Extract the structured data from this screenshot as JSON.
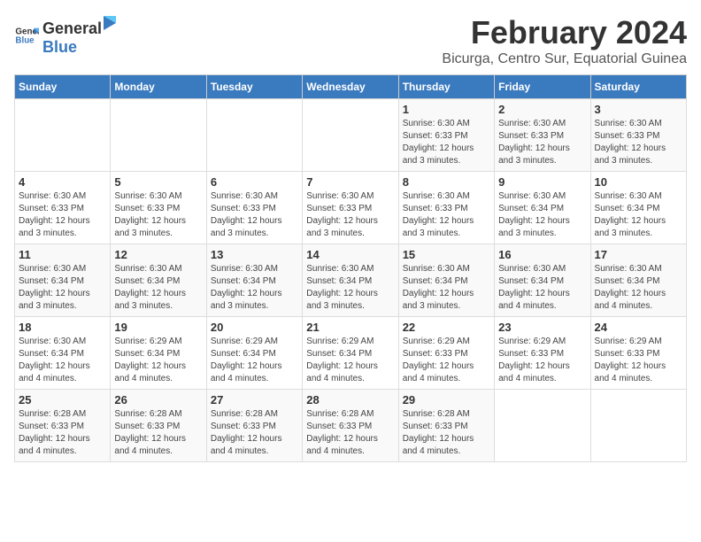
{
  "header": {
    "logo": {
      "general": "General",
      "blue": "Blue"
    },
    "title": "February 2024",
    "subtitle": "Bicurga, Centro Sur, Equatorial Guinea"
  },
  "days_of_week": [
    "Sunday",
    "Monday",
    "Tuesday",
    "Wednesday",
    "Thursday",
    "Friday",
    "Saturday"
  ],
  "weeks": [
    [
      {
        "day": "",
        "info": ""
      },
      {
        "day": "",
        "info": ""
      },
      {
        "day": "",
        "info": ""
      },
      {
        "day": "",
        "info": ""
      },
      {
        "day": "1",
        "info": "Sunrise: 6:30 AM\nSunset: 6:33 PM\nDaylight: 12 hours and 3 minutes."
      },
      {
        "day": "2",
        "info": "Sunrise: 6:30 AM\nSunset: 6:33 PM\nDaylight: 12 hours and 3 minutes."
      },
      {
        "day": "3",
        "info": "Sunrise: 6:30 AM\nSunset: 6:33 PM\nDaylight: 12 hours and 3 minutes."
      }
    ],
    [
      {
        "day": "4",
        "info": "Sunrise: 6:30 AM\nSunset: 6:33 PM\nDaylight: 12 hours and 3 minutes."
      },
      {
        "day": "5",
        "info": "Sunrise: 6:30 AM\nSunset: 6:33 PM\nDaylight: 12 hours and 3 minutes."
      },
      {
        "day": "6",
        "info": "Sunrise: 6:30 AM\nSunset: 6:33 PM\nDaylight: 12 hours and 3 minutes."
      },
      {
        "day": "7",
        "info": "Sunrise: 6:30 AM\nSunset: 6:33 PM\nDaylight: 12 hours and 3 minutes."
      },
      {
        "day": "8",
        "info": "Sunrise: 6:30 AM\nSunset: 6:33 PM\nDaylight: 12 hours and 3 minutes."
      },
      {
        "day": "9",
        "info": "Sunrise: 6:30 AM\nSunset: 6:34 PM\nDaylight: 12 hours and 3 minutes."
      },
      {
        "day": "10",
        "info": "Sunrise: 6:30 AM\nSunset: 6:34 PM\nDaylight: 12 hours and 3 minutes."
      }
    ],
    [
      {
        "day": "11",
        "info": "Sunrise: 6:30 AM\nSunset: 6:34 PM\nDaylight: 12 hours and 3 minutes."
      },
      {
        "day": "12",
        "info": "Sunrise: 6:30 AM\nSunset: 6:34 PM\nDaylight: 12 hours and 3 minutes."
      },
      {
        "day": "13",
        "info": "Sunrise: 6:30 AM\nSunset: 6:34 PM\nDaylight: 12 hours and 3 minutes."
      },
      {
        "day": "14",
        "info": "Sunrise: 6:30 AM\nSunset: 6:34 PM\nDaylight: 12 hours and 3 minutes."
      },
      {
        "day": "15",
        "info": "Sunrise: 6:30 AM\nSunset: 6:34 PM\nDaylight: 12 hours and 3 minutes."
      },
      {
        "day": "16",
        "info": "Sunrise: 6:30 AM\nSunset: 6:34 PM\nDaylight: 12 hours and 4 minutes."
      },
      {
        "day": "17",
        "info": "Sunrise: 6:30 AM\nSunset: 6:34 PM\nDaylight: 12 hours and 4 minutes."
      }
    ],
    [
      {
        "day": "18",
        "info": "Sunrise: 6:30 AM\nSunset: 6:34 PM\nDaylight: 12 hours and 4 minutes."
      },
      {
        "day": "19",
        "info": "Sunrise: 6:29 AM\nSunset: 6:34 PM\nDaylight: 12 hours and 4 minutes."
      },
      {
        "day": "20",
        "info": "Sunrise: 6:29 AM\nSunset: 6:34 PM\nDaylight: 12 hours and 4 minutes."
      },
      {
        "day": "21",
        "info": "Sunrise: 6:29 AM\nSunset: 6:34 PM\nDaylight: 12 hours and 4 minutes."
      },
      {
        "day": "22",
        "info": "Sunrise: 6:29 AM\nSunset: 6:33 PM\nDaylight: 12 hours and 4 minutes."
      },
      {
        "day": "23",
        "info": "Sunrise: 6:29 AM\nSunset: 6:33 PM\nDaylight: 12 hours and 4 minutes."
      },
      {
        "day": "24",
        "info": "Sunrise: 6:29 AM\nSunset: 6:33 PM\nDaylight: 12 hours and 4 minutes."
      }
    ],
    [
      {
        "day": "25",
        "info": "Sunrise: 6:28 AM\nSunset: 6:33 PM\nDaylight: 12 hours and 4 minutes."
      },
      {
        "day": "26",
        "info": "Sunrise: 6:28 AM\nSunset: 6:33 PM\nDaylight: 12 hours and 4 minutes."
      },
      {
        "day": "27",
        "info": "Sunrise: 6:28 AM\nSunset: 6:33 PM\nDaylight: 12 hours and 4 minutes."
      },
      {
        "day": "28",
        "info": "Sunrise: 6:28 AM\nSunset: 6:33 PM\nDaylight: 12 hours and 4 minutes."
      },
      {
        "day": "29",
        "info": "Sunrise: 6:28 AM\nSunset: 6:33 PM\nDaylight: 12 hours and 4 minutes."
      },
      {
        "day": "",
        "info": ""
      },
      {
        "day": "",
        "info": ""
      }
    ]
  ]
}
